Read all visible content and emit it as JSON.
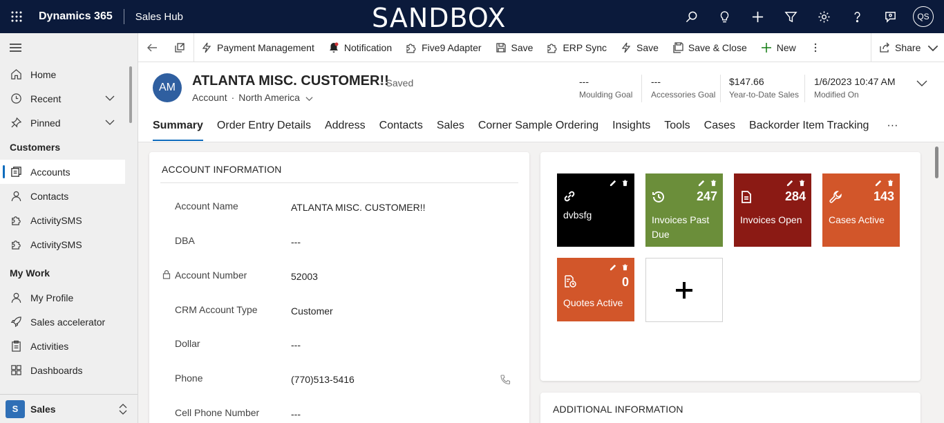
{
  "topbar": {
    "app_name": "Dynamics 365",
    "hub_name": "Sales Hub",
    "environment_banner": "SANDBOX",
    "user_initials": "QS",
    "icons": [
      "search-icon",
      "lightbulb-icon",
      "plus-icon",
      "filter-icon",
      "gear-icon",
      "help-icon",
      "chat-icon"
    ]
  },
  "sidebar": {
    "top_items": [
      {
        "label": "Home",
        "icon": "home-icon"
      },
      {
        "label": "Recent",
        "icon": "clock-icon"
      },
      {
        "label": "Pinned",
        "icon": "pin-icon"
      }
    ],
    "sections": [
      {
        "title": "Customers",
        "items": [
          {
            "label": "Accounts",
            "icon": "account-icon",
            "active": true
          },
          {
            "label": "Contacts",
            "icon": "person-icon"
          },
          {
            "label": "ActivitySMS",
            "icon": "puzzle-icon"
          },
          {
            "label": "ActivitySMS",
            "icon": "puzzle-icon"
          }
        ]
      },
      {
        "title": "My Work",
        "items": [
          {
            "label": "My Profile",
            "icon": "person-icon"
          },
          {
            "label": "Sales accelerator",
            "icon": "rocket-icon"
          },
          {
            "label": "Activities",
            "icon": "clipboard-icon"
          },
          {
            "label": "Dashboards",
            "icon": "dashboard-icon"
          }
        ]
      }
    ],
    "area": {
      "badge": "S",
      "label": "Sales"
    }
  },
  "commandbar": {
    "buttons": [
      {
        "label": "Payment Management",
        "icon": "flash-icon"
      },
      {
        "label": "Notification",
        "icon": "bell-icon"
      },
      {
        "label": "Five9 Adapter",
        "icon": "puzzle-icon"
      },
      {
        "label": "Save",
        "icon": "save-icon"
      },
      {
        "label": "ERP Sync",
        "icon": "puzzle-icon"
      },
      {
        "label": "Save",
        "icon": "flash-icon"
      },
      {
        "label": "Save & Close",
        "icon": "save-close-icon"
      },
      {
        "label": "New",
        "icon": "plus-icon"
      }
    ],
    "share_label": "Share"
  },
  "record": {
    "initials": "AM",
    "title": "ATLANTA MISC. CUSTOMER!!",
    "status": "- Saved",
    "entity": "Account",
    "dot": "·",
    "form": "North America",
    "kpis": [
      {
        "value": "---",
        "label": "Moulding Goal"
      },
      {
        "value": "---",
        "label": "Accessories Goal"
      },
      {
        "value": "$147.66",
        "label": "Year-to-Date Sales"
      },
      {
        "value": "1/6/2023 10:47 AM",
        "label": "Modified On"
      }
    ],
    "tabs": [
      "Summary",
      "Order Entry Details",
      "Address",
      "Contacts",
      "Sales",
      "Corner Sample Ordering",
      "Insights",
      "Tools",
      "Cases",
      "Backorder Item Tracking",
      "···"
    ],
    "active_tab": "Summary"
  },
  "account_info": {
    "title": "ACCOUNT INFORMATION",
    "fields": [
      {
        "label": "Account Name",
        "value": "ATLANTA MISC. CUSTOMER!!"
      },
      {
        "label": "DBA",
        "value": "---"
      },
      {
        "label": "Account Number",
        "value": "52003",
        "locked": true
      },
      {
        "label": "CRM Account Type",
        "value": "Customer"
      },
      {
        "label": "Dollar",
        "value": "---"
      },
      {
        "label": "Phone",
        "value": "(770)513-5416",
        "phone": true
      },
      {
        "label": "Cell Phone Number",
        "value": "---"
      }
    ]
  },
  "tiles": [
    {
      "label": "dvbsfg",
      "count": "",
      "color": "#000000",
      "icon": "link-icon"
    },
    {
      "label": "Invoices Past Due",
      "count": "247",
      "color": "#6b8e3a",
      "icon": "history-icon"
    },
    {
      "label": "Invoices Open",
      "count": "284",
      "color": "#8b1a14",
      "icon": "document-icon"
    },
    {
      "label": "Cases Active",
      "count": "143",
      "color": "#d2562a",
      "icon": "wrench-icon"
    },
    {
      "label": "Quotes Active",
      "count": "0",
      "color": "#d2562a",
      "icon": "quote-clock-icon"
    }
  ],
  "additional_info": {
    "title": "ADDITIONAL INFORMATION"
  }
}
